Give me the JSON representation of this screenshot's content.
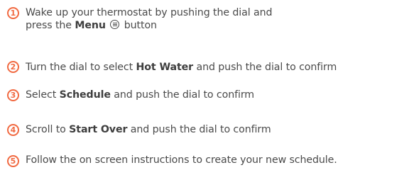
{
  "steps": [
    {
      "number": "1",
      "line1": "Wake up your thermostat by pushing the dial and",
      "line2_prefix": "press the ",
      "line2_bold": "Menu",
      "line2_icon": "menu-icon",
      "line2_suffix": "button"
    },
    {
      "number": "2",
      "prefix": "Turn the dial to select ",
      "bold": "Hot Water",
      "suffix": " and push the dial to confirm"
    },
    {
      "number": "3",
      "prefix": "Select ",
      "bold": "Schedule",
      "suffix": " and push the dial to confirm"
    },
    {
      "number": "4",
      "prefix": "Scroll to ",
      "bold": "Start Over",
      "suffix": " and push the dial to confirm"
    },
    {
      "number": "5",
      "text": "Follow the on screen instructions to create your new schedule."
    }
  ],
  "colors": {
    "accent": "#f16a42",
    "text": "#4a4a4a"
  }
}
